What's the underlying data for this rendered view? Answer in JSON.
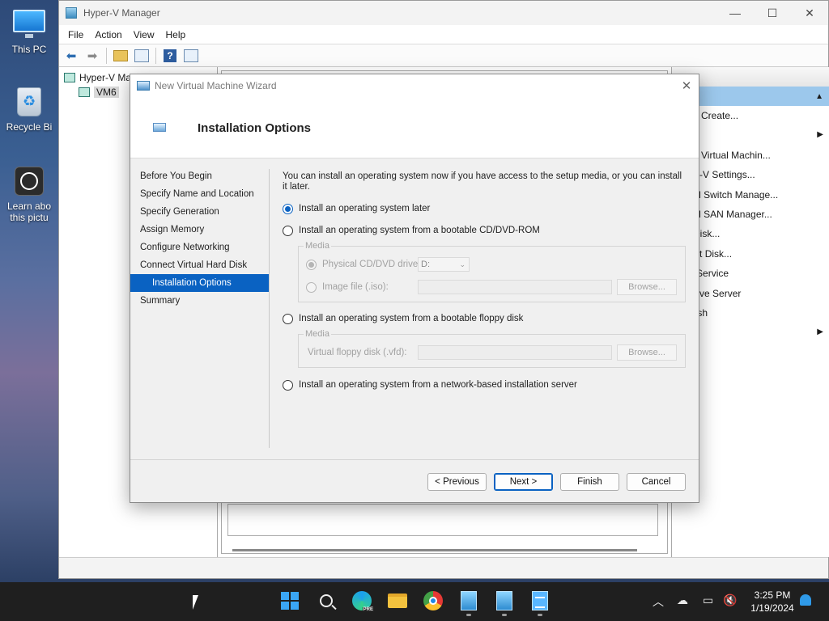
{
  "desktop": {
    "icons": [
      {
        "label": "This PC"
      },
      {
        "label": "Recycle Bi"
      },
      {
        "label": "Learn abo",
        "label2": "this pictu"
      }
    ]
  },
  "hyperv": {
    "title": "Hyper-V Manager",
    "menu": [
      "File",
      "Action",
      "View",
      "Help"
    ],
    "tree": {
      "root": "Hyper-V Ma",
      "child": "VM6"
    },
    "actions": {
      "header": "ns",
      "items": [
        {
          "label": "Quick Create...",
          "submenu": false
        },
        {
          "label": "New",
          "submenu": true
        },
        {
          "label": "mport Virtual Machin...",
          "submenu": false
        },
        {
          "label": "Hyper-V Settings...",
          "submenu": false
        },
        {
          "label": "Virtual Switch Manage...",
          "submenu": false
        },
        {
          "label": "Virtual SAN Manager...",
          "submenu": false
        },
        {
          "label": "Edit Disk...",
          "submenu": false
        },
        {
          "label": "nspect Disk...",
          "submenu": false
        },
        {
          "label": "Stop Service",
          "submenu": false
        },
        {
          "label": "Remove Server",
          "submenu": false
        },
        {
          "label": "Refresh",
          "submenu": false
        },
        {
          "label": "View",
          "submenu": true
        },
        {
          "label": "Help",
          "submenu": false
        }
      ]
    }
  },
  "wizard": {
    "title": "New Virtual Machine Wizard",
    "page_title": "Installation Options",
    "nav": [
      {
        "label": "Before You Begin"
      },
      {
        "label": "Specify Name and Location"
      },
      {
        "label": "Specify Generation"
      },
      {
        "label": "Assign Memory"
      },
      {
        "label": "Configure Networking"
      },
      {
        "label": "Connect Virtual Hard Disk"
      },
      {
        "label": "Installation Options",
        "selected": true
      },
      {
        "label": "Summary"
      }
    ],
    "intro": "You can install an operating system now if you have access to the setup media, or you can install it later.",
    "options": {
      "later": "Install an operating system later",
      "cd": "Install an operating system from a bootable CD/DVD-ROM",
      "floppy": "Install an operating system from a bootable floppy disk",
      "network": "Install an operating system from a network-based installation server"
    },
    "selected_option": "later",
    "cd_media": {
      "legend": "Media",
      "physical_label": "Physical CD/DVD drive:",
      "drive_value": "D:",
      "image_label": "Image file (.iso):",
      "browse": "Browse..."
    },
    "floppy_media": {
      "legend": "Media",
      "vfd_label": "Virtual floppy disk (.vfd):",
      "browse": "Browse..."
    },
    "buttons": {
      "previous": "< Previous",
      "next": "Next >",
      "finish": "Finish",
      "cancel": "Cancel"
    }
  },
  "taskbar": {
    "clock_time": "3:25 PM",
    "clock_date": "1/19/2024",
    "edge_badge": "PRE"
  },
  "colors": {
    "selection": "#0a62c2",
    "actions_highlight": "#9cc8ec"
  }
}
